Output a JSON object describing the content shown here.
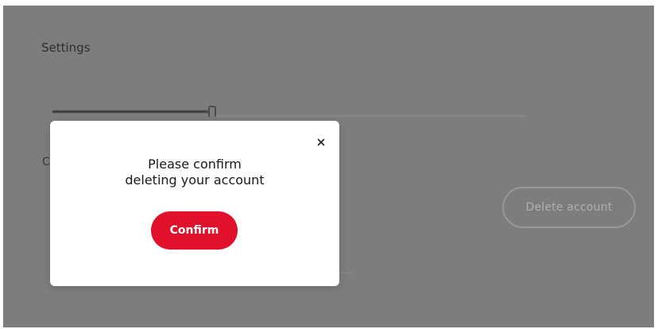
{
  "page": {
    "title": "Settings",
    "left_fragment": "C"
  },
  "account": {
    "delete_label": "Delete account"
  },
  "modal": {
    "line1": "Please confirm",
    "line2": "deleting your account",
    "confirm_label": "Confirm",
    "close_symbol": "×"
  },
  "colors": {
    "overlay_bg": "#7d7d7d",
    "confirm_accent": "#e1102b",
    "modal_bg": "#ffffff"
  },
  "icons": {
    "close": "close-icon"
  }
}
